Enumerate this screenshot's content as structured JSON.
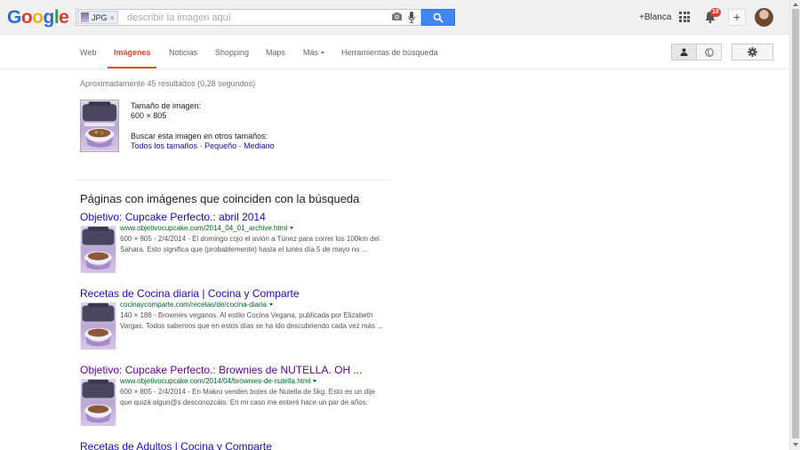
{
  "header": {
    "logo_text": "Google",
    "search": {
      "chip_label": "JPG",
      "chip_remove": "×",
      "placeholder": "describir la imagen aquí",
      "value": ""
    },
    "user_link": "+Blanca",
    "notifications_count": "18",
    "share_label": "+",
    "icons": [
      "camera-icon",
      "mic-icon",
      "search-icon",
      "apps-icon",
      "bell-icon",
      "plus-icon",
      "avatar"
    ],
    "colors": {
      "search_button": "#4285f4",
      "badge": "#d23f31"
    }
  },
  "nav": {
    "tabs": [
      {
        "label": "Web"
      },
      {
        "label": "Imágenes",
        "active": true
      },
      {
        "label": "Noticias"
      },
      {
        "label": "Shopping"
      },
      {
        "label": "Maps"
      },
      {
        "label": "Más"
      },
      {
        "label": "Herramientas de búsqueda"
      }
    ],
    "icons": [
      "person-icon",
      "globe-icon",
      "gear-icon"
    ],
    "active_color": "#dd4b39"
  },
  "stats": "Aproximadamente 45 resultados (0,28 segundos)",
  "image_info": {
    "size_label": "Tamaño de imagen:",
    "size_value": "600 × 805",
    "other_sizes_label": "Buscar esta imagen en otros tamaños:",
    "links": [
      "Todos los tamaños",
      "Pequeño",
      "Mediano"
    ],
    "link_separator": "-"
  },
  "section_title": "Páginas con imágenes que coinciden con la búsqueda",
  "results": [
    {
      "title": "Objetivo: Cupcake Perfecto.: abril 2014",
      "visited": false,
      "url": "www.objetivocupcake.com/2014_04_01_archive.html",
      "snippet": "600 × 805 - 2/4/2014 - El domingo cojo el avión a Túnez para correr los 100km del Sahara. Esto significa que (probablemente) hasta el lunes día 5 de mayo no ..."
    },
    {
      "title": "Recetas de Cocina diaria | Cocina y Comparte",
      "visited": false,
      "url": "cocinaycomparte.com/recetas/de/cocina-diaria",
      "snippet": "140 × 188 - Brownies veganos. Al estilo Cocina Vegana, publicada por Elizabeth Vargas. Todos sabemos que en estos días se ha ido descubriendo cada vez más ..."
    },
    {
      "title": "Objetivo: Cupcake Perfecto.: Brownies de NUTELLA. OH ...",
      "visited": true,
      "url": "www.objetivocupcake.com/2014/04/brownies-de-nutella.html",
      "snippet": "600 × 805 - 2/4/2014 - En Makro venden botes de Nutella de 5kg. Esto es un dije que quizá algun@s desconozcáis. En mi caso me enteré hace un par de años."
    },
    {
      "title": "Recetas de Adultos | Cocina y Comparte",
      "visited": false,
      "url": "",
      "snippet": ""
    }
  ]
}
